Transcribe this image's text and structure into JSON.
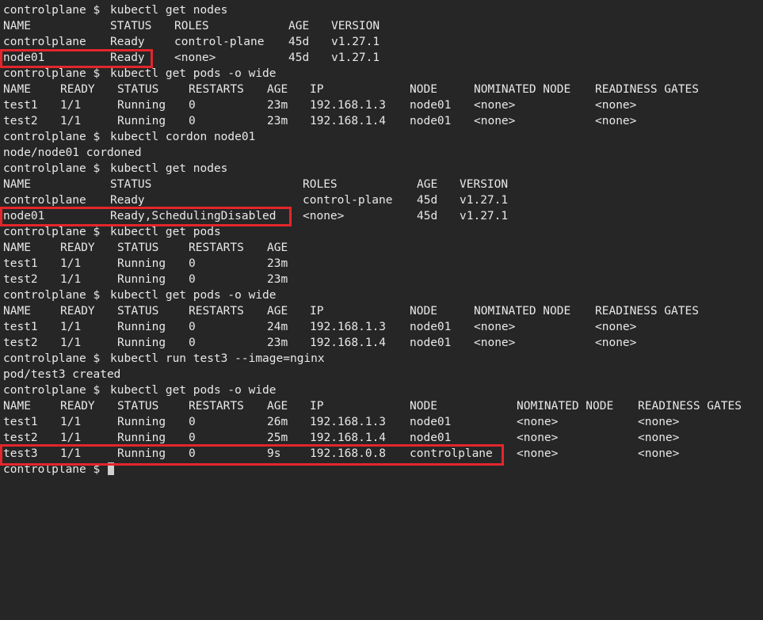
{
  "prompt": "controlplane $",
  "cmd_get_nodes_1": "kubectl get nodes",
  "nodes1": {
    "headers": [
      "NAME",
      "STATUS",
      "ROLES",
      "AGE",
      "VERSION"
    ],
    "rows": [
      [
        "controlplane",
        "Ready",
        "control-plane",
        "45d",
        "v1.27.1"
      ],
      [
        "node01",
        "Ready",
        "<none>",
        "45d",
        "v1.27.1"
      ]
    ]
  },
  "cmd_get_pods_wide_1": "kubectl get pods -o wide",
  "pods_wide1": {
    "headers": [
      "NAME",
      "READY",
      "STATUS",
      "RESTARTS",
      "AGE",
      "IP",
      "NODE",
      "NOMINATED NODE",
      "READINESS GATES"
    ],
    "rows": [
      [
        "test1",
        "1/1",
        "Running",
        "0",
        "23m",
        "192.168.1.3",
        "node01",
        "<none>",
        "<none>"
      ],
      [
        "test2",
        "1/1",
        "Running",
        "0",
        "23m",
        "192.168.1.4",
        "node01",
        "<none>",
        "<none>"
      ]
    ]
  },
  "cmd_cordon": "kubectl cordon node01",
  "cordon_output": "node/node01 cordoned",
  "cmd_get_nodes_2": "kubectl get nodes",
  "nodes2": {
    "headers": [
      "NAME",
      "STATUS",
      "ROLES",
      "AGE",
      "VERSION"
    ],
    "rows": [
      [
        "controlplane",
        "Ready",
        "control-plane",
        "45d",
        "v1.27.1"
      ],
      [
        "node01",
        "Ready,SchedulingDisabled",
        "<none>",
        "45d",
        "v1.27.1"
      ]
    ]
  },
  "cmd_get_pods": "kubectl get pods",
  "pods": {
    "headers": [
      "NAME",
      "READY",
      "STATUS",
      "RESTARTS",
      "AGE"
    ],
    "rows": [
      [
        "test1",
        "1/1",
        "Running",
        "0",
        "23m"
      ],
      [
        "test2",
        "1/1",
        "Running",
        "0",
        "23m"
      ]
    ]
  },
  "cmd_get_pods_wide_2": "kubectl get pods -o wide",
  "pods_wide2": {
    "headers": [
      "NAME",
      "READY",
      "STATUS",
      "RESTARTS",
      "AGE",
      "IP",
      "NODE",
      "NOMINATED NODE",
      "READINESS GATES"
    ],
    "rows": [
      [
        "test1",
        "1/1",
        "Running",
        "0",
        "24m",
        "192.168.1.3",
        "node01",
        "<none>",
        "<none>"
      ],
      [
        "test2",
        "1/1",
        "Running",
        "0",
        "23m",
        "192.168.1.4",
        "node01",
        "<none>",
        "<none>"
      ]
    ]
  },
  "cmd_run": "kubectl run test3 --image=nginx",
  "run_output": "pod/test3 created",
  "cmd_get_pods_wide_3": "kubectl get pods -o wide",
  "pods_wide3": {
    "headers": [
      "NAME",
      "READY",
      "STATUS",
      "RESTARTS",
      "AGE",
      "IP",
      "NODE",
      "NOMINATED NODE",
      "READINESS GATES"
    ],
    "rows": [
      [
        "test1",
        "1/1",
        "Running",
        "0",
        "26m",
        "192.168.1.3",
        "node01",
        "<none>",
        "<none>"
      ],
      [
        "test2",
        "1/1",
        "Running",
        "0",
        "25m",
        "192.168.1.4",
        "node01",
        "<none>",
        "<none>"
      ],
      [
        "test3",
        "1/1",
        "Running",
        "0",
        "9s",
        "192.168.0.8",
        "controlplane",
        "<none>",
        "<none>"
      ]
    ]
  },
  "colors": {
    "background": "#262626",
    "text": "#e8e8e8",
    "highlight": "#e3262c"
  }
}
